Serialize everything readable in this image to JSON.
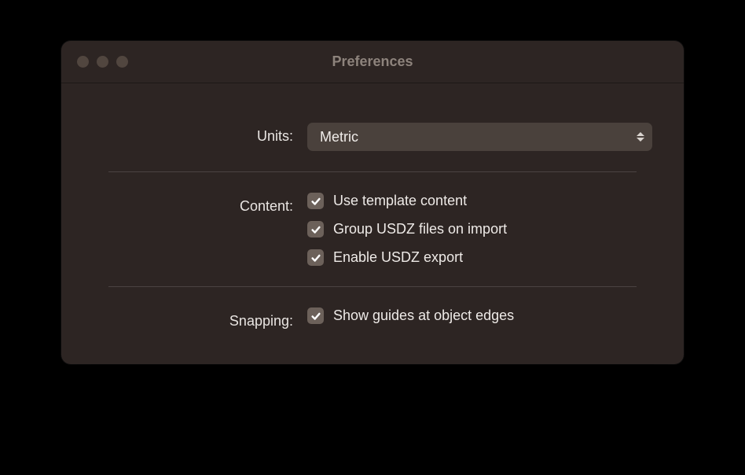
{
  "window": {
    "title": "Preferences"
  },
  "units": {
    "label": "Units:",
    "selected": "Metric"
  },
  "content": {
    "label": "Content:",
    "options": [
      {
        "label": "Use template content",
        "checked": true
      },
      {
        "label": "Group USDZ files on import",
        "checked": true
      },
      {
        "label": "Enable USDZ export",
        "checked": true
      }
    ]
  },
  "snapping": {
    "label": "Snapping:",
    "options": [
      {
        "label": "Show guides at object edges",
        "checked": true
      }
    ]
  }
}
